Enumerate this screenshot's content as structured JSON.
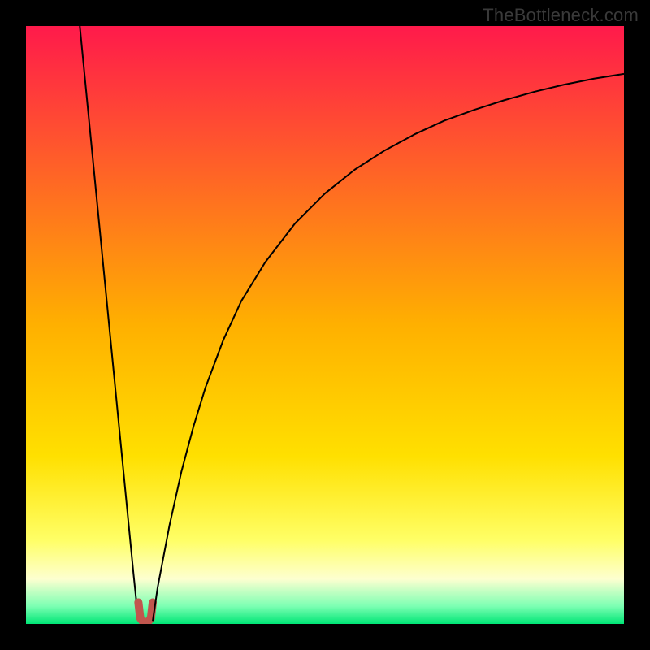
{
  "watermark": "TheBottleneck.com",
  "chart_data": {
    "type": "line",
    "title": "",
    "xlabel": "",
    "ylabel": "",
    "xlim": [
      0,
      100
    ],
    "ylim": [
      0,
      100
    ],
    "grid": false,
    "legend": false,
    "background_gradient": {
      "stops": [
        {
          "pos": 0.0,
          "color": "#ff1a4b"
        },
        {
          "pos": 0.5,
          "color": "#ffb000"
        },
        {
          "pos": 0.72,
          "color": "#ffe000"
        },
        {
          "pos": 0.86,
          "color": "#ffff66"
        },
        {
          "pos": 0.925,
          "color": "#fdffd0"
        },
        {
          "pos": 0.97,
          "color": "#7dffb3"
        },
        {
          "pos": 1.0,
          "color": "#00e676"
        }
      ]
    },
    "series": [
      {
        "name": "left-branch",
        "color": "#000000",
        "width": 2,
        "x": [
          9.0,
          10.0,
          11.0,
          12.0,
          13.0,
          14.0,
          15.0,
          16.0,
          17.0,
          18.0,
          18.8
        ],
        "y": [
          100.0,
          89.8,
          79.6,
          69.4,
          59.2,
          49.0,
          38.8,
          28.6,
          18.4,
          8.2,
          0.5
        ]
      },
      {
        "name": "dip-arc",
        "color": "#c1564e",
        "width": 10,
        "cap": "round",
        "x": [
          18.8,
          19.1,
          19.7,
          20.3,
          20.9,
          21.2
        ],
        "y": [
          3.6,
          1.0,
          0.2,
          0.2,
          1.0,
          3.6
        ]
      },
      {
        "name": "right-branch",
        "color": "#000000",
        "width": 2,
        "x": [
          21.2,
          22,
          24,
          26,
          28,
          30,
          33,
          36,
          40,
          45,
          50,
          55,
          60,
          65,
          70,
          75,
          80,
          85,
          90,
          95,
          100
        ],
        "y": [
          0.5,
          6.0,
          16.5,
          25.5,
          33.0,
          39.5,
          47.5,
          54.0,
          60.5,
          67.0,
          72.0,
          76.0,
          79.2,
          81.9,
          84.2,
          86.0,
          87.6,
          89.0,
          90.2,
          91.2,
          92.0
        ]
      }
    ]
  }
}
